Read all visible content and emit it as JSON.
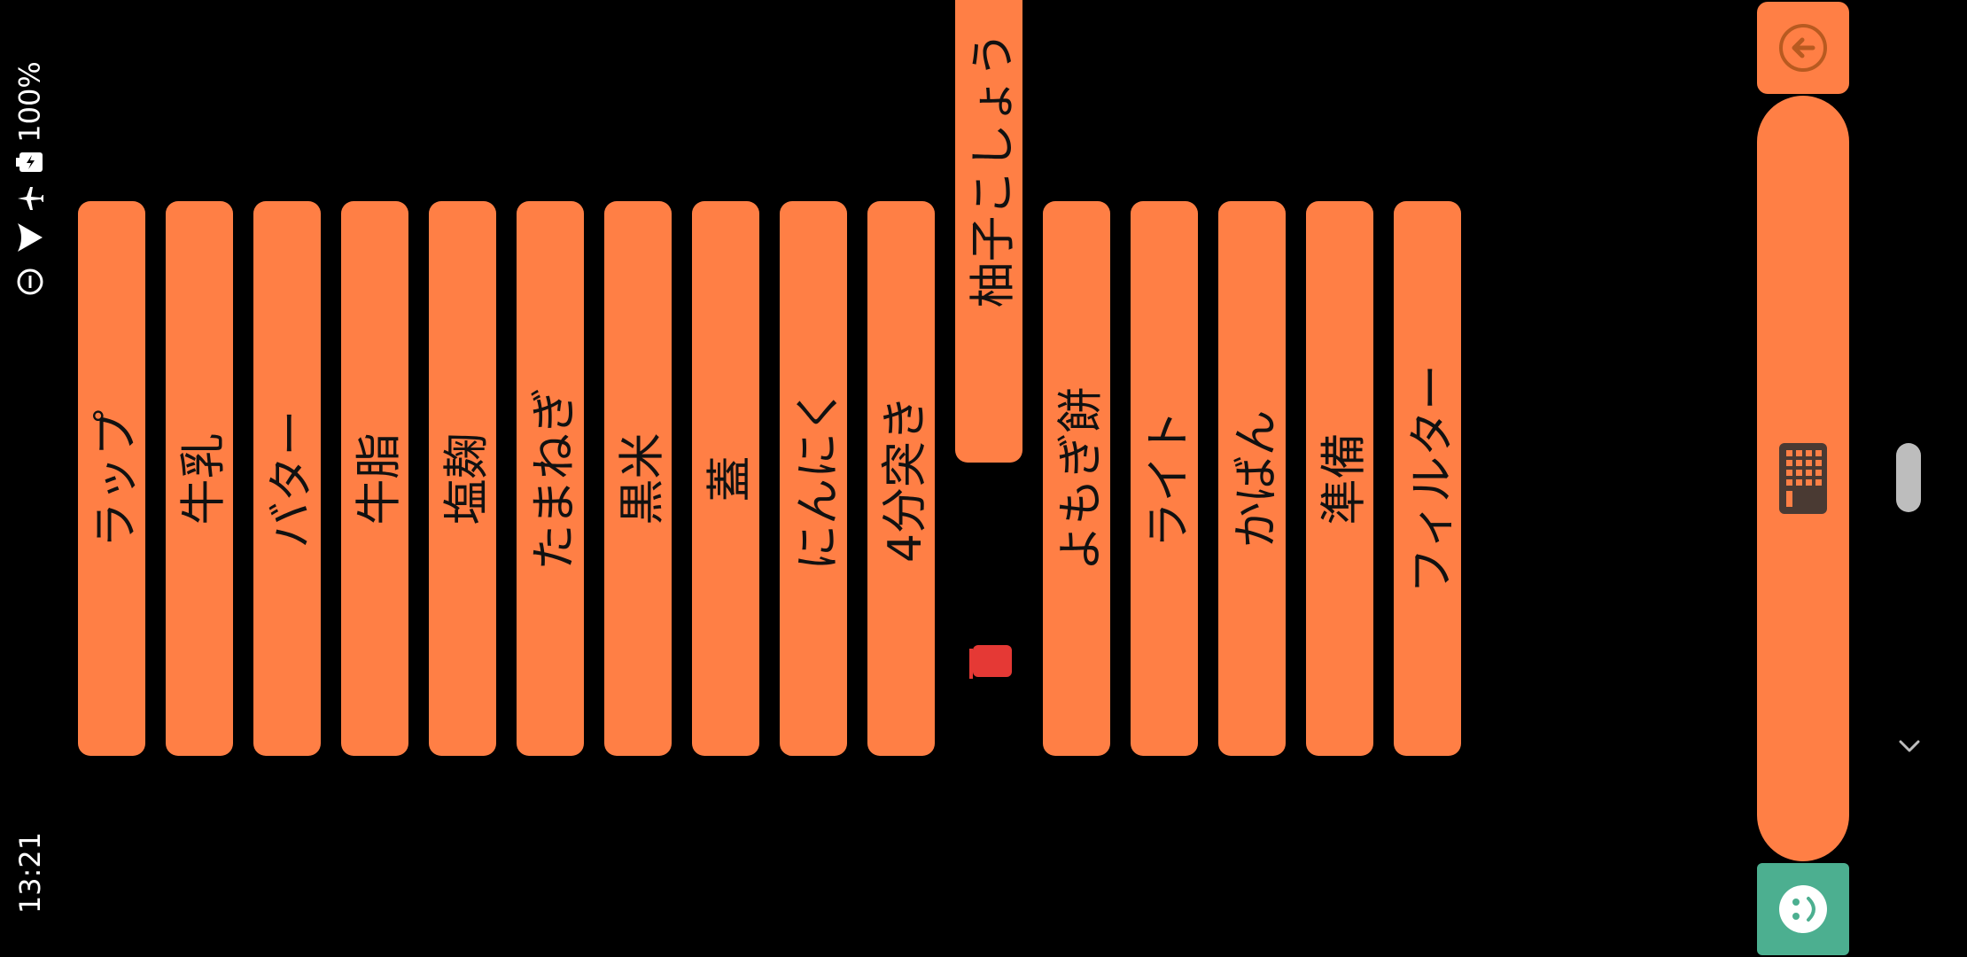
{
  "status_bar": {
    "time": "13:21",
    "battery": "100%"
  },
  "ingredients": [
    {
      "label": "ラップ"
    },
    {
      "label": "牛乳"
    },
    {
      "label": "バター"
    },
    {
      "label": "牛脂"
    },
    {
      "label": "塩麹"
    },
    {
      "label": "たまねぎ"
    },
    {
      "label": "黒米"
    },
    {
      "label": "蓋"
    },
    {
      "label": "にんにく"
    },
    {
      "label": "4分突き"
    },
    {
      "label": "柚子こしょう"
    },
    {
      "label": "よもぎ餅"
    },
    {
      "label": "ライト"
    },
    {
      "label": "かばん"
    },
    {
      "label": "準備"
    },
    {
      "label": "フィルター"
    }
  ],
  "icons": {
    "back": "back-arrow-icon",
    "keyboard": "keyboard-icon",
    "emoji": "emoji-icon",
    "marker": "flag-icon",
    "chevron": "chevron-down-icon"
  },
  "colors": {
    "button": "#ff7f45",
    "emoji_button": "#4caf90",
    "marker": "#e53935"
  }
}
